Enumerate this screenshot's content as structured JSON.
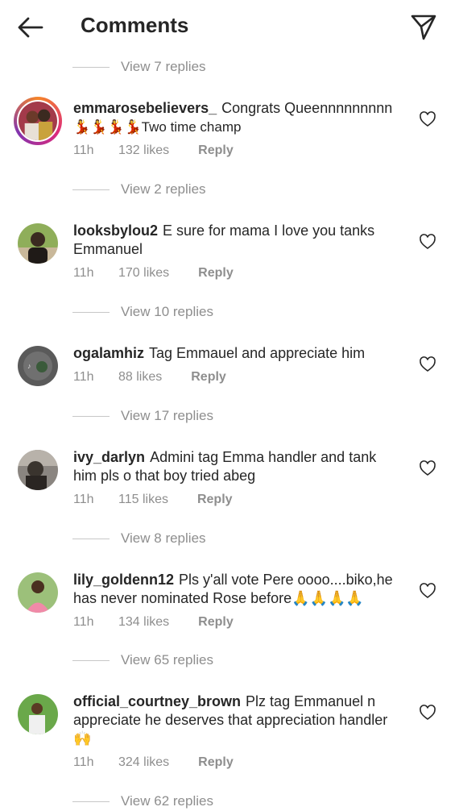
{
  "header": {
    "title": "Comments",
    "back_icon": "arrow-left-icon",
    "send_icon": "paper-plane-icon"
  },
  "top_replies": "View 7 replies",
  "comments": [
    {
      "username": "emmarosebelievers_",
      "text": "Congrats Queennnnnnnnn",
      "text_line2": "💃💃💃💃Two time champ",
      "time": "11h",
      "likes": "132 likes",
      "reply": "Reply",
      "replies": "View 2 replies"
    },
    {
      "username": "looksbylou2",
      "text": "E sure for mama I love you tanks Emmanuel",
      "time": "11h",
      "likes": "170 likes",
      "reply": "Reply",
      "replies": "View 10 replies"
    },
    {
      "username": "ogalamhiz",
      "text": "Tag Emmauel and appreciate him",
      "time": "11h",
      "likes": "88 likes",
      "reply": "Reply",
      "replies": "View 17 replies"
    },
    {
      "username": "ivy_darlyn",
      "text": "Admini tag Emma handler and tank him pls o that boy tried abeg",
      "time": "11h",
      "likes": "115 likes",
      "reply": "Reply",
      "replies": "View 8 replies"
    },
    {
      "username": "lily_goldenn12",
      "text": "Pls y'all vote Pere oooo....biko,he has never nominated Rose before🙏🙏🙏🙏",
      "time": "11h",
      "likes": "134 likes",
      "reply": "Reply",
      "replies": "View 65 replies"
    },
    {
      "username": "official_courtney_brown",
      "text": "Plz tag Emmanuel n appreciate he deserves that appreciation handler🙌",
      "time": "11h",
      "likes": "324 likes",
      "reply": "Reply",
      "replies": "View 62 replies"
    }
  ],
  "colors": {
    "text": "#262626",
    "secondary": "#8e8e8e",
    "divider": "#c7c7c7"
  }
}
